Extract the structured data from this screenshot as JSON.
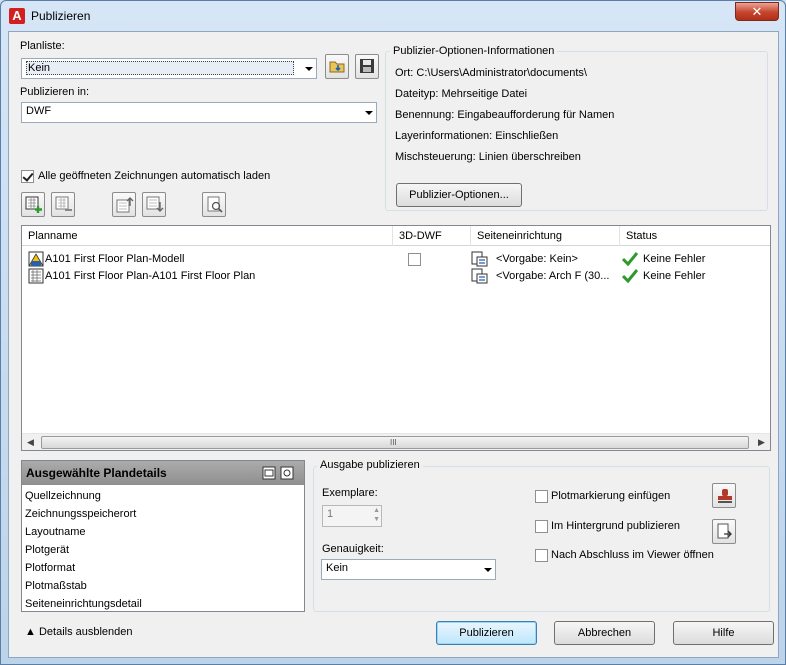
{
  "window": {
    "title": "Publizieren",
    "app_icon": "A",
    "close": "✕"
  },
  "sheet_list": {
    "label": "Planliste:",
    "value": "Kein",
    "load_icon": "folder-load-icon",
    "save_icon": "floppy-save-icon"
  },
  "publish_to": {
    "label": "Publizieren in:",
    "value": "DWF"
  },
  "auto_load": {
    "label": "Alle geöffneten Zeichnungen automatisch laden",
    "checked": true
  },
  "options_info": {
    "title": "Publizier-Optionen-Informationen",
    "rows": [
      {
        "key": "Ort:",
        "value": "C:\\Users\\Administrator\\documents\\"
      },
      {
        "key": "Dateityp:",
        "value": "Mehrseitige Datei"
      },
      {
        "key": "Benennung:",
        "value": "Eingabeaufforderung für Namen"
      },
      {
        "key": "Layerinformationen:",
        "value": "Einschließen"
      },
      {
        "key": "Mischsteuerung:",
        "value": "Linien überschreiben"
      }
    ],
    "button": "Publizier-Optionen..."
  },
  "list": {
    "columns": [
      "Planname",
      "3D-DWF",
      "Seiteneinrichtung",
      "Status"
    ],
    "rows": [
      {
        "name": "A101 First Floor Plan-Modell",
        "dwf3d": false,
        "page_setup": "<Vorgabe: Kein>",
        "status": "Keine Fehler"
      },
      {
        "name": "A101 First Floor Plan-A101 First Floor Plan",
        "dwf3d": false,
        "page_setup": "<Vorgabe: Arch F (30...",
        "status": "Keine Fehler"
      }
    ],
    "scroll_grip": "III"
  },
  "details": {
    "title": "Ausgewählte Plandetails",
    "items": [
      "Quellzeichnung",
      "Zeichnungsspeicherort",
      "Layoutname",
      "Plotgerät",
      "Plotformat",
      "Plotmaßstab",
      "Seiteneinrichtungsdetail"
    ]
  },
  "output": {
    "title": "Ausgabe publizieren",
    "copies_label": "Exemplare:",
    "copies_value": "1",
    "precision_label": "Genauigkeit:",
    "precision_value": "Kein",
    "stamp_label": "Plotmarkierung einfügen",
    "background_label": "Im Hintergrund publizieren",
    "open_viewer_label": "Nach Abschluss im Viewer öffnen"
  },
  "footer": {
    "hide_details": "Details ausblenden",
    "publish": "Publizieren",
    "cancel": "Abbrechen",
    "help": "Hilfe"
  },
  "colors": {
    "accent_red": "#d21f1f",
    "check_green": "#2e9a2e",
    "selection_bg": "#e8eef6"
  }
}
